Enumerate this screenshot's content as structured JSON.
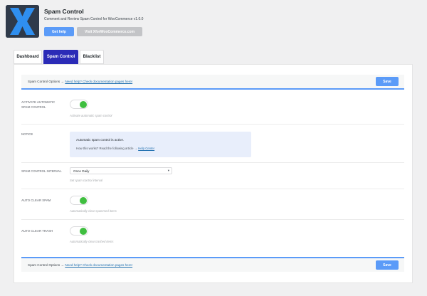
{
  "header": {
    "title": "Spam Control",
    "subtitle": "Comment and Review Spam Control for WooCommerce v1.0.0",
    "help_button": "Get help",
    "visit_button": "Visit XforWooCommerce.com"
  },
  "tabs": [
    {
      "label": "Dashboard",
      "active": false
    },
    {
      "label": "Spam Control",
      "active": true
    },
    {
      "label": "Blacklist",
      "active": false
    }
  ],
  "options_bar": {
    "prefix": "Spam Control Options → ",
    "link_text": "Need help? Check documentation pages here!",
    "save_label": "Save"
  },
  "settings": {
    "auto_spam_control": {
      "label": "Activate Automatic Spam Control",
      "description": "Activate automatic spam control",
      "enabled": true
    },
    "notice": {
      "label": "Notice",
      "line1": "Automatic spam control is active.",
      "line2_prefix": "How this works? Read the following article → ",
      "line2_link": "Help Center"
    },
    "interval": {
      "label": "Spam Control Interval",
      "value": "Once Daily",
      "description": "Set spam control interval"
    },
    "auto_clear_spam": {
      "label": "Auto Clear Spam",
      "description": "Automatically clear spammed items",
      "enabled": true
    },
    "auto_clear_trash": {
      "label": "Auto Clear Trash",
      "description": "Automatically clear trashed items",
      "enabled": true
    }
  },
  "colors": {
    "accent": "#5b9bf8",
    "active_tab": "#2b2bb7",
    "toggle_on": "#3fbe3f"
  }
}
